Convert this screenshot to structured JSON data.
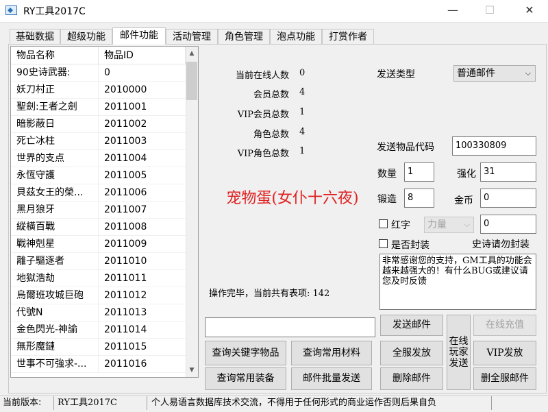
{
  "window": {
    "title": "RY工具2017C",
    "controls": {
      "minimize": "—",
      "maximize": "☐",
      "close": "✕"
    }
  },
  "tabs": [
    {
      "label": "基础数据"
    },
    {
      "label": "超级功能"
    },
    {
      "label": "邮件功能"
    },
    {
      "label": "活动管理"
    },
    {
      "label": "角色管理"
    },
    {
      "label": "泡点功能"
    },
    {
      "label": "打赏作者"
    }
  ],
  "active_tab": "邮件功能",
  "item_list": {
    "headers": [
      "物品名称",
      "物品ID"
    ],
    "rows": [
      [
        "90史诗武器:",
        "0"
      ],
      [
        "妖刀村正",
        "2010000"
      ],
      [
        "聖劍:王者之劍",
        "2011001"
      ],
      [
        "暗影蔽日",
        "2011002"
      ],
      [
        "死亡冰柱",
        "2011003"
      ],
      [
        "世界的支点",
        "2011004"
      ],
      [
        "永恆守護",
        "2011005"
      ],
      [
        "貝茲女王的榮...",
        "2011006"
      ],
      [
        "黑月狼牙",
        "2011007"
      ],
      [
        "縱橫百戰",
        "2011008"
      ],
      [
        "戰神剋星",
        "2011009"
      ],
      [
        "離子驅逐者",
        "2011010"
      ],
      [
        "地獄浩劫",
        "2011011"
      ],
      [
        "烏爾班攻城巨砲",
        "2011012"
      ],
      [
        "代號N",
        "2011013"
      ],
      [
        "金色閃光-神諭",
        "2011014"
      ],
      [
        "無形魔鏈",
        "2011015"
      ],
      [
        "世事不可強求-...",
        "2011016"
      ]
    ]
  },
  "stats": {
    "online_label": "当前在线人数",
    "online_value": "0",
    "members_label": "会员总数",
    "members_value": "4",
    "vip_label": "VIP会员总数",
    "vip_value": "1",
    "roles_label": "角色总数",
    "roles_value": "4",
    "vip_roles_label": "VIP角色总数",
    "vip_roles_value": "1"
  },
  "selected_item_name": "宠物蛋(女仆十六夜)",
  "status_message": "操作完毕，当前共有表项: 142",
  "mail": {
    "send_type_label": "发送类型",
    "send_type_value": "普通邮件",
    "item_code_label": "发送物品代码",
    "item_code_value": "100330809",
    "quantity_label": "数量",
    "quantity_value": "1",
    "enhance_label": "强化",
    "enhance_value": "31",
    "forge_label": "锻造",
    "forge_value": "8",
    "gold_label": "金币",
    "gold_value": "0",
    "red_label": "红字",
    "red_select_value": "力量",
    "red_value": "0",
    "seal_label": "是否封装",
    "epic_note": "史诗请勿封装",
    "message": "非常感谢您的支持，GM工具的功能会越来越强大的！有什么BUG或建议请您及时反馈",
    "search_input_value": ""
  },
  "buttons": {
    "send_mail": "发送邮件",
    "online_recharge": "在线充值",
    "query_keyword_items": "查询关键字物品",
    "query_common_materials": "查询常用材料",
    "server_wide_send": "全服发放",
    "online_player_send": "在线玩家发送",
    "vip_send": "VIP发放",
    "query_common_equipment": "查询常用装备",
    "batch_mail_send": "邮件批量发送",
    "delete_mail": "删除邮件",
    "delete_all_server_mail": "删全服邮件"
  },
  "statusbar": {
    "version_label": "当前版本:",
    "version_value": "RY工具2017C",
    "disclaimer": "个人易语言数据库技术交流，不得用于任何形式的商业运作否则后果自负"
  },
  "colors": {
    "highlight_red": "#e02020",
    "disabled_text": "#a0a0a0"
  }
}
